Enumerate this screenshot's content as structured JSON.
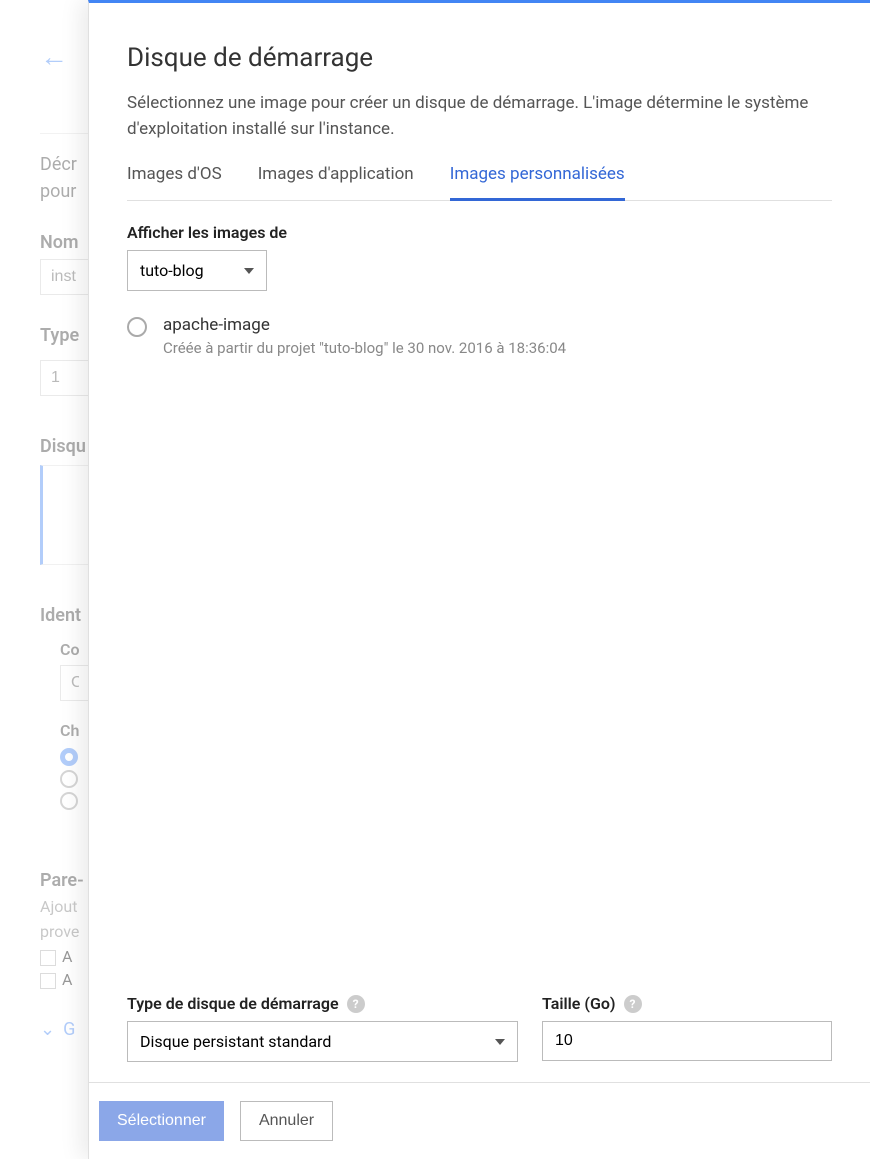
{
  "background": {
    "desc_line1": "Décr",
    "desc_line2": "pour",
    "name_label": "Nom",
    "name_value": "inst",
    "type_label": "Type",
    "type_value": "1",
    "disk_label": "Disqu",
    "ident_label": "Ident",
    "co_label": "Co",
    "co_value": "C",
    "ch_label": "Ch",
    "pare_label": "Pare-",
    "ajout_line": "Ajout",
    "prov_line": "prove",
    "check_a1": "A",
    "check_a2": "A",
    "expand_g": "G"
  },
  "modal": {
    "title": "Disque de démarrage",
    "subtitle": "Sélectionnez une image pour créer un disque de démarrage. L'image détermine le système d'exploitation installé sur l'instance.",
    "tabs": [
      {
        "label": "Images d'OS",
        "active": false
      },
      {
        "label": "Images d'application",
        "active": false
      },
      {
        "label": "Images personnalisées",
        "active": true
      }
    ],
    "show_images_label": "Afficher les images de",
    "project_select": "tuto-blog",
    "images": [
      {
        "name": "apache-image",
        "meta": "Créée à partir du projet \"tuto-blog\" le 30 nov. 2016 à 18:36:04",
        "selected": false
      }
    ],
    "disk_type_label": "Type de disque de démarrage",
    "disk_type_value": "Disque persistant standard",
    "size_label": "Taille (Go)",
    "size_value": "10",
    "select_button": "Sélectionner",
    "cancel_button": "Annuler"
  }
}
